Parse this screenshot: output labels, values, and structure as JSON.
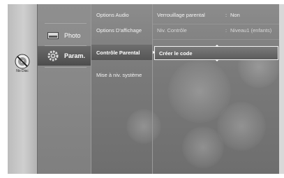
{
  "disc": {
    "label": "No Disc",
    "icon": "no-disc-icon"
  },
  "categories": [
    {
      "label": "Photo",
      "icon": "photo-icon",
      "active": false
    },
    {
      "label": "Param.",
      "icon": "gear-icon",
      "active": true
    }
  ],
  "submenu": {
    "items": [
      {
        "label": "Options Audio"
      },
      {
        "label": "Options D'affichage"
      },
      {
        "label": "Contrôle Parental",
        "selected": true
      },
      {
        "label": "Mise à niv. système"
      }
    ]
  },
  "options": {
    "rows": [
      {
        "label": "Verrouillage parental",
        "colon": ":",
        "value": "Non"
      },
      {
        "label": "Niv. Contrôle",
        "colon": ":",
        "value": "Niveau1 (enfants)"
      }
    ],
    "selected_label": "Créer le code"
  },
  "colors": {
    "background": "#7a7a7a",
    "highlight": "#555555",
    "text": "#ffffff"
  }
}
